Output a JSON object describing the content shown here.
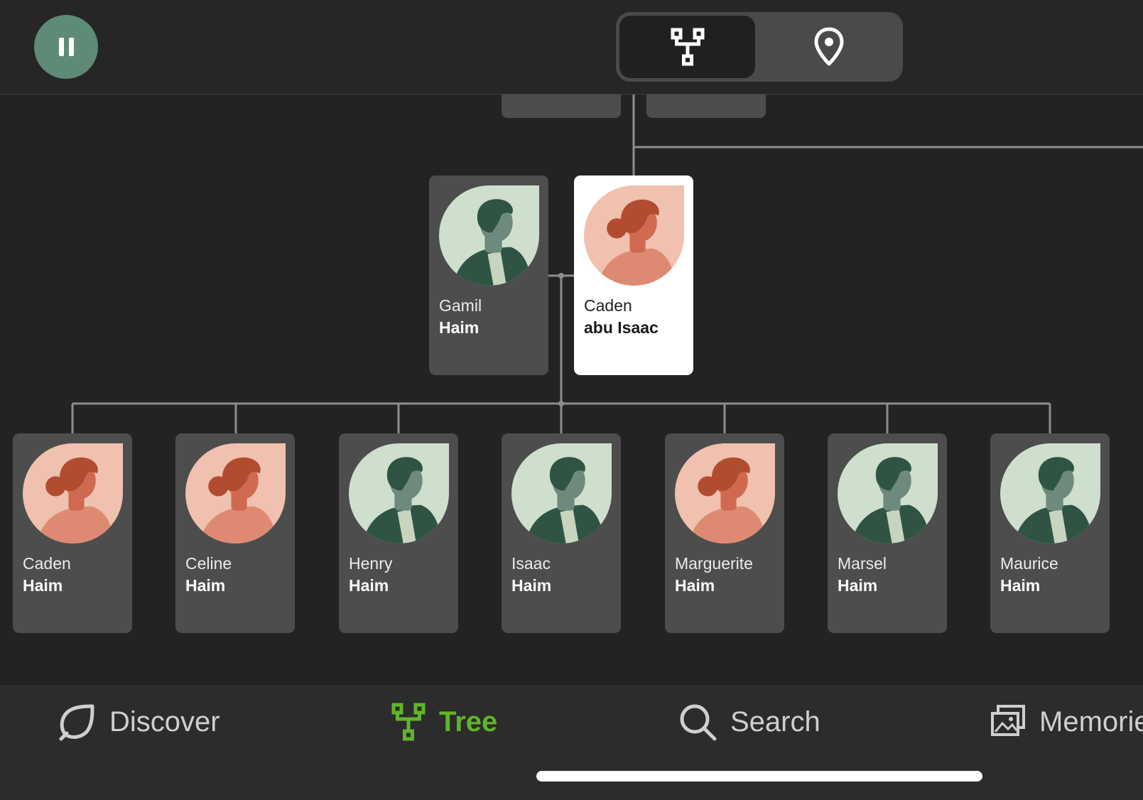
{
  "header": {
    "pause_icon": "pause-icon",
    "view_toggle": [
      {
        "name": "tree-view",
        "icon": "tree-icon",
        "active": true
      },
      {
        "name": "map-view",
        "icon": "location-pin-icon",
        "active": false
      }
    ]
  },
  "tree": {
    "parents": [
      {
        "first": "Gamil",
        "last": "Haim",
        "gender": "male",
        "selected": false
      },
      {
        "first": "Caden",
        "last": "abu Isaac",
        "gender": "female",
        "selected": true
      }
    ],
    "children": [
      {
        "first": "Caden",
        "last": "Haim",
        "gender": "female"
      },
      {
        "first": "Celine",
        "last": "Haim",
        "gender": "female"
      },
      {
        "first": "Henry",
        "last": "Haim",
        "gender": "male"
      },
      {
        "first": "Isaac",
        "last": "Haim",
        "gender": "male"
      },
      {
        "first": "Marguerite",
        "last": "Haim",
        "gender": "female"
      },
      {
        "first": "Marsel",
        "last": "Haim",
        "gender": "male"
      },
      {
        "first": "Maurice",
        "last": "Haim",
        "gender": "male"
      }
    ]
  },
  "nav": {
    "items": [
      {
        "label": "Discover",
        "icon": "leaf-icon",
        "active": false
      },
      {
        "label": "Tree",
        "icon": "tree-icon",
        "active": true
      },
      {
        "label": "Search",
        "icon": "search-icon",
        "active": false
      },
      {
        "label": "Memories",
        "icon": "photos-icon",
        "active": false
      }
    ]
  },
  "colors": {
    "background": "#232323",
    "card": "#4d4d4d",
    "selected_card": "#ffffff",
    "accent_green": "#5fb52a",
    "pause_button": "#5e8a78",
    "female_bg": "#efc1ae",
    "male_bg": "#cfdfcd"
  }
}
